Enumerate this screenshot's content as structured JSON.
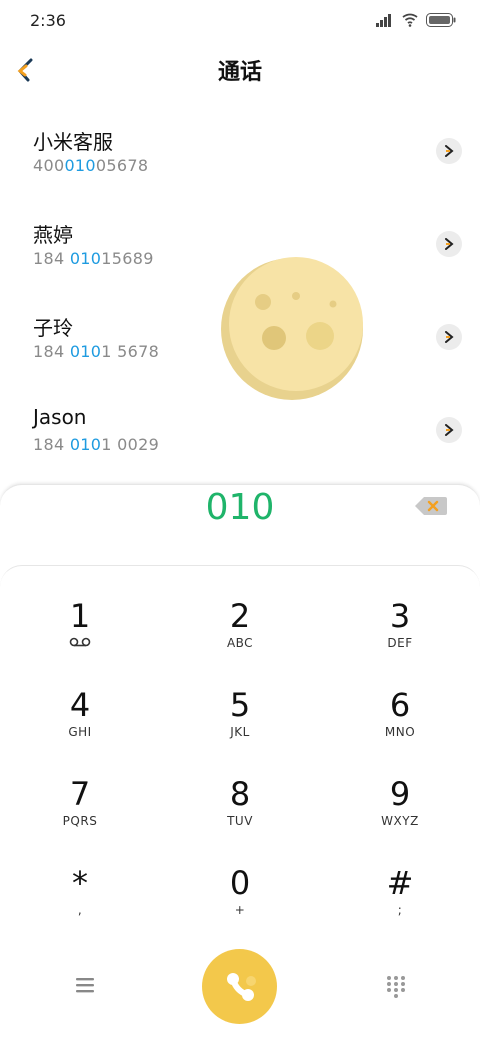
{
  "status_bar": {
    "time": "2:36",
    "icons": [
      "signal-icon",
      "wifi-icon",
      "battery-icon"
    ]
  },
  "header": {
    "title": "通话",
    "back_icon": "back-arrow-icon"
  },
  "contacts": [
    {
      "name": "小米客服",
      "number_pre": "400",
      "number_match": "010",
      "number_post": "05678"
    },
    {
      "name": "燕婷",
      "number_pre": "184 ",
      "number_match": "010",
      "number_post": "15689"
    },
    {
      "name": "子玲",
      "number_pre": "184 ",
      "number_match": "010",
      "number_post": "1 5678"
    },
    {
      "name": "Jason",
      "number_pre": "184 ",
      "number_match": "010",
      "number_post": "1 0029"
    }
  ],
  "dialer": {
    "entered_number": "010",
    "keys": [
      {
        "digit": "1",
        "sub": ""
      },
      {
        "digit": "2",
        "sub": "ABC"
      },
      {
        "digit": "3",
        "sub": "DEF"
      },
      {
        "digit": "4",
        "sub": "GHI"
      },
      {
        "digit": "5",
        "sub": "JKL"
      },
      {
        "digit": "6",
        "sub": "MNO"
      },
      {
        "digit": "7",
        "sub": "PQRS"
      },
      {
        "digit": "8",
        "sub": "TUV"
      },
      {
        "digit": "9",
        "sub": "WXYZ"
      },
      {
        "digit": "*",
        "sub": ","
      },
      {
        "digit": "0",
        "sub": "+"
      },
      {
        "digit": "#",
        "sub": ";"
      }
    ]
  },
  "colors": {
    "match_highlight": "#1e9be0",
    "dialed_number": "#1fb46a",
    "call_button": "#f3c84b"
  }
}
